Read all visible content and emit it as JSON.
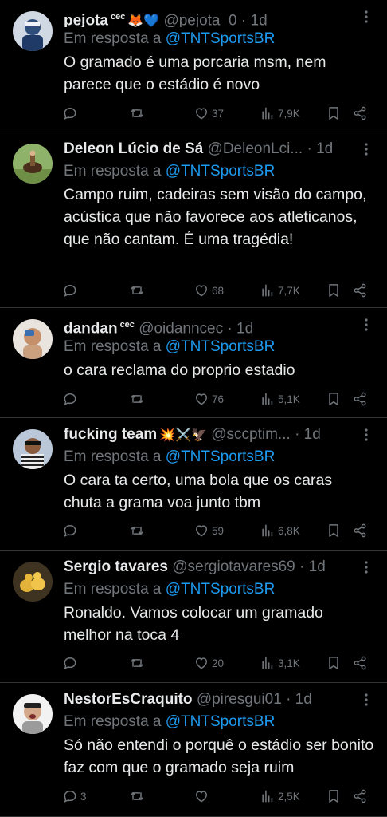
{
  "colors": {
    "background": "#000000",
    "text": "#e7e9ea",
    "muted": "#71767b",
    "link": "#1d9bf0",
    "divider": "#2f3336"
  },
  "reply_prefix": "Em resposta a",
  "tweets": [
    {
      "name": "pejota",
      "badge": "cec",
      "emojis": "🦊💙",
      "handle": "@pejota_0",
      "separator": "·",
      "time": "1d",
      "reply_to": "@TNTSportsBR",
      "text": "O gramado é uma porcaria msm, nem parece que o estádio é novo",
      "replies": "",
      "retweets": "",
      "likes": "37",
      "views": "7,9K",
      "icons": [
        "more-icon",
        "reply-icon",
        "retweet-icon",
        "like-icon",
        "views-icon",
        "bookmark-icon",
        "share-icon"
      ]
    },
    {
      "name": "Deleon Lúcio de Sá",
      "badge": "",
      "emojis": "",
      "handle": "@DeleonLci...",
      "separator": "·",
      "time": "1d",
      "reply_to": "@TNTSportsBR",
      "text": "Campo ruim, cadeiras sem visão do campo, acústica que não favorece aos atleticanos, que não cantam. É uma tragédia!",
      "replies": "",
      "retweets": "",
      "likes": "68",
      "views": "7,7K"
    },
    {
      "name": "dandan",
      "badge": "cec",
      "emojis": "",
      "handle": "@oidanncec",
      "separator": "·",
      "time": "1d",
      "reply_to": "@TNTSportsBR",
      "text": "o cara reclama do proprio estadio",
      "replies": "",
      "retweets": "",
      "likes": "76",
      "views": "5,1K"
    },
    {
      "name": "fucking team",
      "badge": "",
      "emojis": "💥⚔️🦅",
      "handle": "@sccptim...",
      "separator": "·",
      "time": "1d",
      "reply_to": "@TNTSportsBR",
      "text": "O cara ta certo, uma bola que os caras chuta a grama voa junto tbm",
      "replies": "",
      "retweets": "",
      "likes": "59",
      "views": "6,8K"
    },
    {
      "name": "Sergio tavares",
      "badge": "",
      "emojis": "",
      "handle": "@sergiotavares69",
      "separator": "·",
      "time": "1d",
      "reply_to": "@TNTSportsBR",
      "text": "Ronaldo. Vamos colocar um gramado melhor na toca 4",
      "replies": "",
      "retweets": "",
      "likes": "20",
      "views": "3,1K"
    },
    {
      "name": "NestorEsCraquito",
      "badge": "",
      "emojis": "",
      "handle": "@piresgui01",
      "separator": "·",
      "time": "1d",
      "reply_to": "@TNTSportsBR",
      "text": "Só não entendi o porquê o estádio ser bonito faz com que o gramado seja ruim",
      "replies": "3",
      "retweets": "",
      "likes": "",
      "views": "2,5K"
    }
  ]
}
